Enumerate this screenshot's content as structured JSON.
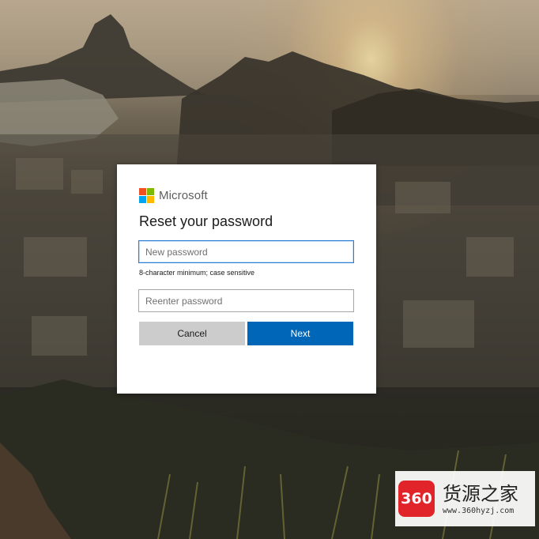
{
  "brand": {
    "name": "Microsoft",
    "logo_colors": [
      "#f25022",
      "#7fba00",
      "#00a4ef",
      "#ffb900"
    ]
  },
  "dialog": {
    "title": "Reset your password",
    "new_password_placeholder": "New password",
    "hint": "8-character minimum; case sensitive",
    "reenter_password_placeholder": "Reenter password",
    "cancel_label": "Cancel",
    "next_label": "Next"
  },
  "colors": {
    "primary": "#0067b8",
    "secondary_button": "#cccccc",
    "focus_border": "#2b7cd3"
  },
  "watermark": {
    "badge": "360",
    "chinese": "货源之家",
    "url": "www.360hyzj.com"
  }
}
